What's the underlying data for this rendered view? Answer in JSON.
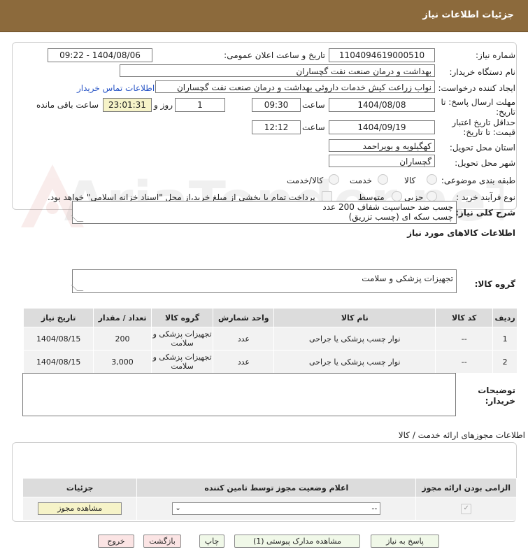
{
  "header": {
    "title": "جزئیات اطلاعات نیاز"
  },
  "form": {
    "need_number_label": "شماره نیاز:",
    "need_number": "1104094619000510",
    "announce_label": "تاریخ و ساعت اعلان عمومی:",
    "announce_value": "1404/08/06 - 09:22",
    "buyer_org_label": "نام دستگاه خریدار:",
    "buyer_org": "بهداشت و درمان صنعت نفت گچساران",
    "creator_label": "ایجاد کننده درخواست:",
    "creator": "نواب زراعت کیش خدمات داروئی بهداشت و درمان صنعت نفت گچساران",
    "contact_link": "اطلاعات تماس خریدار",
    "deadline_label": "مهلت ارسال پاسخ: تا تاریخ:",
    "deadline_date": "1404/08/08",
    "time_label": "ساعت",
    "deadline_time": "09:30",
    "days_value": "1",
    "days_label": "روز و",
    "remaining_time": "23:01:31",
    "remaining_label": "ساعت باقی مانده",
    "validity_label": "حداقل تاریخ اعتبار قیمت: تا تاریخ:",
    "validity_date": "1404/09/19",
    "validity_time": "12:12",
    "province_label": "استان محل تحویل:",
    "province": "کهگیلویه و بویراحمد",
    "city_label": "شهر محل تحویل:",
    "city": "گچساران",
    "category_label": "طبقه بندی موضوعی:",
    "category_options": [
      "کالا",
      "خدمت",
      "کالا/خدمت"
    ],
    "process_label": "نوع فرآیند خرید :",
    "process_options": [
      "جزیی",
      "متوسط"
    ],
    "payment_note": "پرداخت تمام یا بخشی از مبلغ خرید،از محل \"اسناد خزانه اسلامی\" خواهد بود."
  },
  "description": {
    "label": "شرح کلی نیاز:",
    "line1": "چسب ضد حساسیت شفاف 200 عدد",
    "line2": "چسب سکه ای (چسب تزریق)"
  },
  "goods": {
    "section_title": "اطلاعات کالاهای مورد نیاز",
    "group_label": "گروه کالا:",
    "group_value": "تجهیزات پزشکی و سلامت",
    "headers": [
      "ردیف",
      "کد کالا",
      "نام کالا",
      "واحد شمارش",
      "گروه کالا",
      "تعداد / مقدار",
      "تاریخ نیاز"
    ],
    "rows": [
      {
        "row": "1",
        "code": "--",
        "name": "نوار چسب پزشکی یا جراحی",
        "unit": "عدد",
        "group": "تجهیزات پزشکی و سلامت",
        "qty": "200",
        "date": "1404/08/15"
      },
      {
        "row": "2",
        "code": "--",
        "name": "نوار چسب پزشکی یا جراحی",
        "unit": "عدد",
        "group": "تجهیزات پزشکی و سلامت",
        "qty": "3,000",
        "date": "1404/08/15"
      }
    ]
  },
  "buyer_notes": {
    "label": "توضیحات خریدار:"
  },
  "permits": {
    "section_title": "اطلاعات مجوزهای ارائه خدمت / کالا",
    "headers": [
      "الزامی بودن ارائه مجوز",
      "اعلام وضعیت مجوز توسط تامین کننده",
      "جزئیات"
    ],
    "select_value": "--",
    "view_button": "مشاهده مجوز"
  },
  "actions": {
    "reply": "پاسخ به نیاز",
    "attachments": "مشاهده مدارک پیوستی (1)",
    "print": "چاپ",
    "back": "بازگشت",
    "exit": "خروج"
  },
  "watermark": "AriaTender.neT"
}
